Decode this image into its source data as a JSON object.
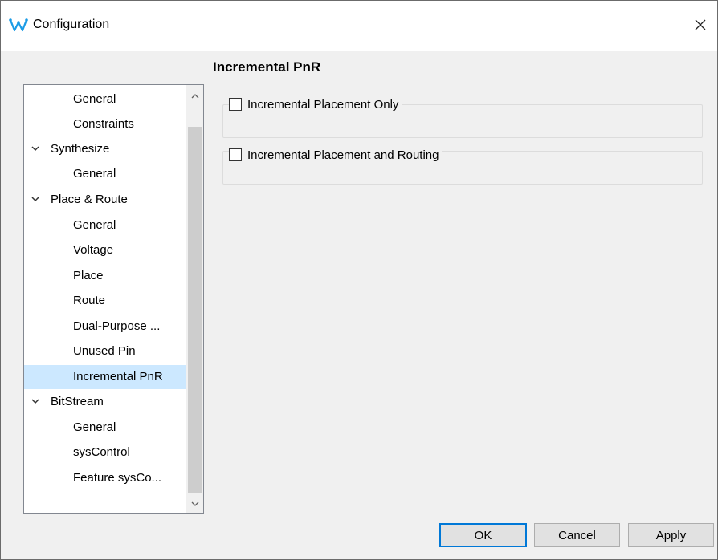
{
  "window": {
    "title": "Configuration"
  },
  "page": {
    "heading": "Incremental PnR"
  },
  "tree": {
    "items": [
      {
        "label": "General"
      },
      {
        "label": "Constraints"
      },
      {
        "label": "Synthesize"
      },
      {
        "label": "General"
      },
      {
        "label": "Place & Route"
      },
      {
        "label": "General"
      },
      {
        "label": "Voltage"
      },
      {
        "label": "Place"
      },
      {
        "label": "Route"
      },
      {
        "label": "Dual-Purpose ..."
      },
      {
        "label": "Unused Pin"
      },
      {
        "label": "Incremental PnR"
      },
      {
        "label": "BitStream"
      },
      {
        "label": "General"
      },
      {
        "label": "sysControl"
      },
      {
        "label": "Feature sysCo..."
      }
    ],
    "selected": "Incremental PnR"
  },
  "options": {
    "placement_only": {
      "label": "Incremental Placement Only",
      "checked": false
    },
    "placement_routing": {
      "label": "Incremental Placement and Routing",
      "checked": false
    }
  },
  "buttons": {
    "ok": "OK",
    "cancel": "Cancel",
    "apply": "Apply"
  },
  "icons": {
    "app": "gowin-logo-icon",
    "close": "close-icon"
  },
  "colors": {
    "selection": "#cce8ff",
    "focus_border": "#0078d7",
    "logo": "#1a9be6"
  }
}
